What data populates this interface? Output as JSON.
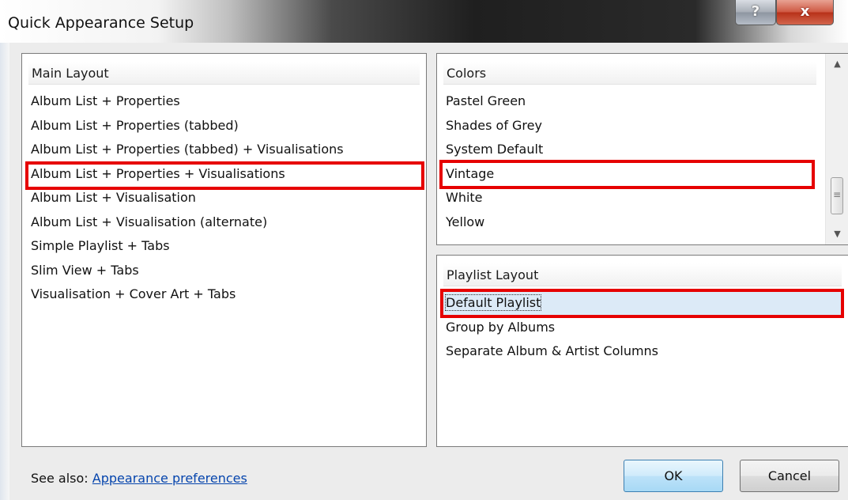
{
  "window": {
    "title": "Quick Appearance Setup",
    "help_label": "?",
    "close_label": "x"
  },
  "main_layout": {
    "header": "Main Layout",
    "items": [
      "Album List + Properties",
      "Album List + Properties (tabbed)",
      "Album List + Properties (tabbed) + Visualisations",
      "Album List + Properties + Visualisations",
      "Album List + Visualisation",
      "Album List + Visualisation (alternate)",
      "Simple Playlist + Tabs",
      "Slim View + Tabs",
      "Visualisation + Cover Art + Tabs"
    ],
    "highlighted_item": "Album List + Properties + Visualisations"
  },
  "colors": {
    "header": "Colors",
    "items": [
      "Pastel Green",
      "Shades of Grey",
      "System Default",
      "Vintage",
      "White",
      "Yellow"
    ],
    "highlighted_item": "Vintage"
  },
  "playlist_layout": {
    "header": "Playlist Layout",
    "items": [
      "Default Playlist",
      "Group by Albums",
      "Separate Album & Artist Columns"
    ],
    "selected_item": "Default Playlist"
  },
  "footer": {
    "see_also_label": "See also:",
    "link_label": "Appearance preferences",
    "ok_label": "OK",
    "cancel_label": "Cancel"
  },
  "annotation_color": "#e60000",
  "selection_color": "#dceaf7",
  "icons": {
    "scroll_up": "scroll-up-arrow-icon",
    "scroll_down": "scroll-down-arrow-icon",
    "scroll_grip": "scroll-grip-icon"
  }
}
